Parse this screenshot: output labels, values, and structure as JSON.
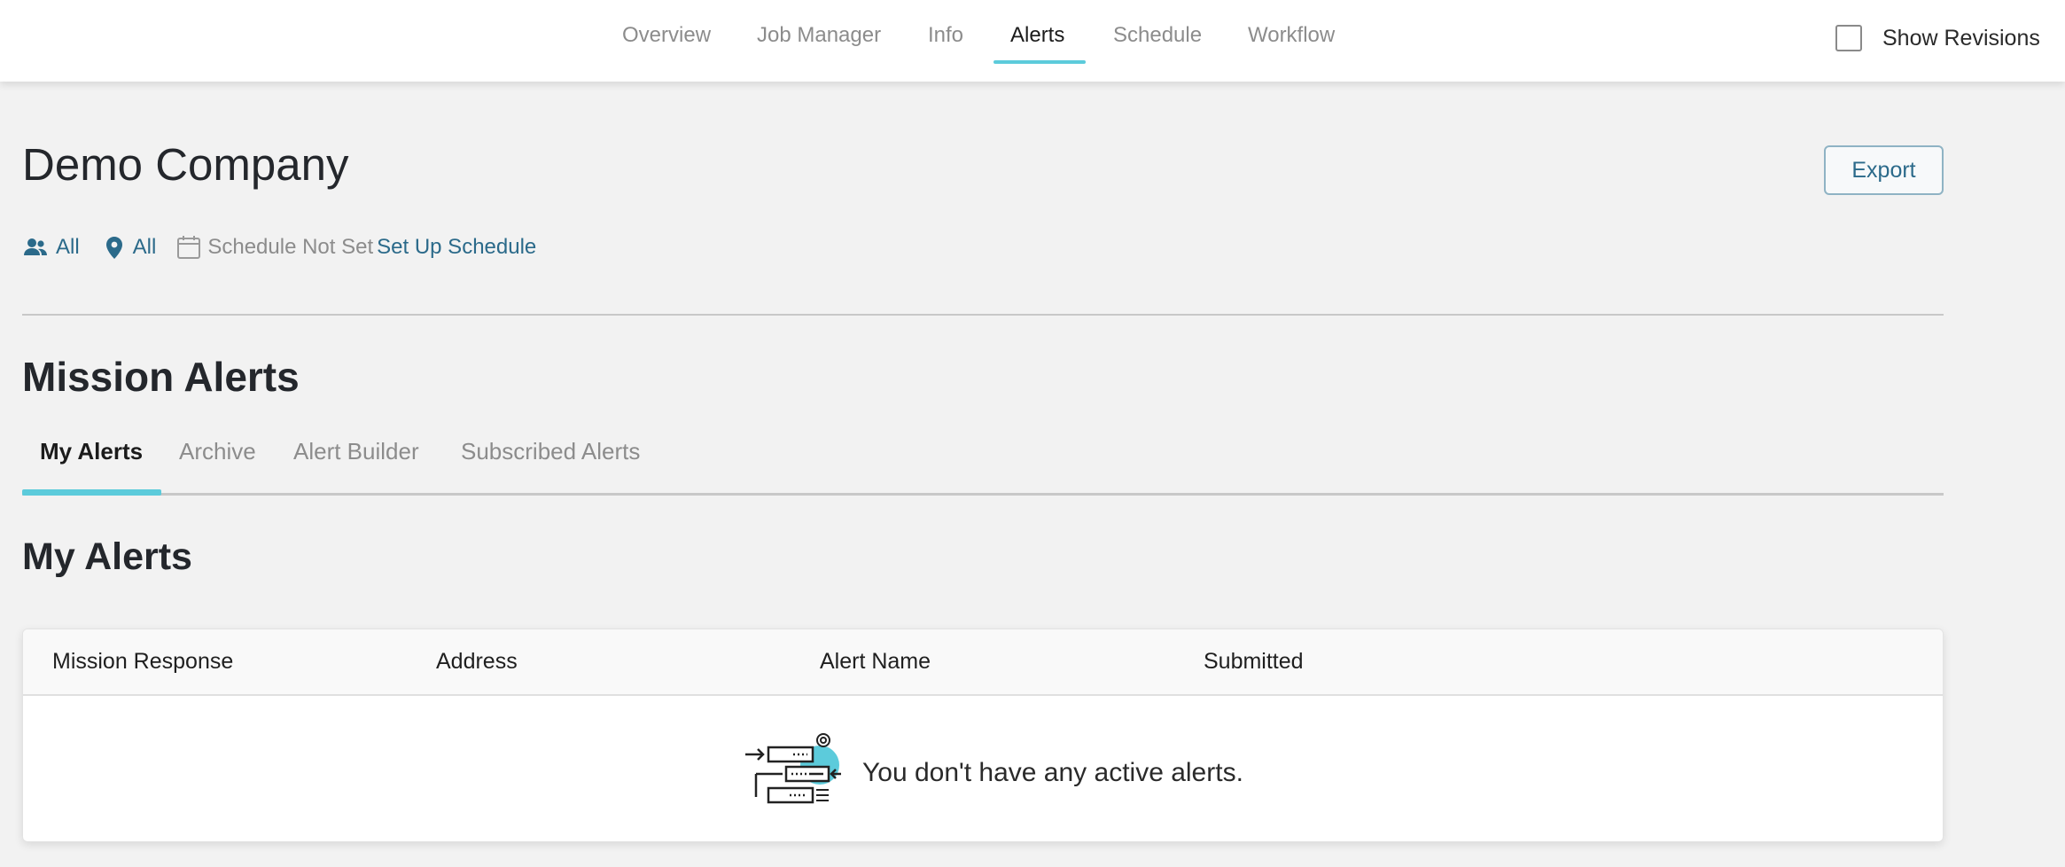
{
  "nav": {
    "tabs": [
      {
        "label": "Overview"
      },
      {
        "label": "Job Manager"
      },
      {
        "label": "Info"
      },
      {
        "label": "Alerts",
        "active": true
      },
      {
        "label": "Schedule"
      },
      {
        "label": "Workflow"
      }
    ],
    "show_revisions": {
      "label": "Show Revisions",
      "checked": false
    }
  },
  "header": {
    "company": "Demo Company",
    "export_label": "Export",
    "meta": {
      "people_label": "All",
      "location_label": "All",
      "schedule_status": "Schedule Not Set",
      "schedule_link": "Set Up Schedule"
    }
  },
  "section": {
    "title": "Mission Alerts",
    "tabs": [
      {
        "label": "My Alerts",
        "active": true
      },
      {
        "label": "Archive"
      },
      {
        "label": "Alert Builder"
      },
      {
        "label": "Subscribed Alerts"
      }
    ],
    "subtitle": "My Alerts"
  },
  "table": {
    "columns": [
      "Mission Response",
      "Address",
      "Alert Name",
      "Submitted"
    ],
    "rows": [],
    "empty_message": "You don't have any active alerts."
  },
  "colors": {
    "accent": "#5ccbdb",
    "link": "#2b6a8a",
    "muted_text": "#8c8c8c",
    "background": "#f2f2f2"
  },
  "icons": {
    "people": "people-icon",
    "location": "location-pin-icon",
    "calendar": "calendar-icon",
    "checkbox": "checkbox-icon",
    "empty_state": "alerts-empty-illustration"
  }
}
